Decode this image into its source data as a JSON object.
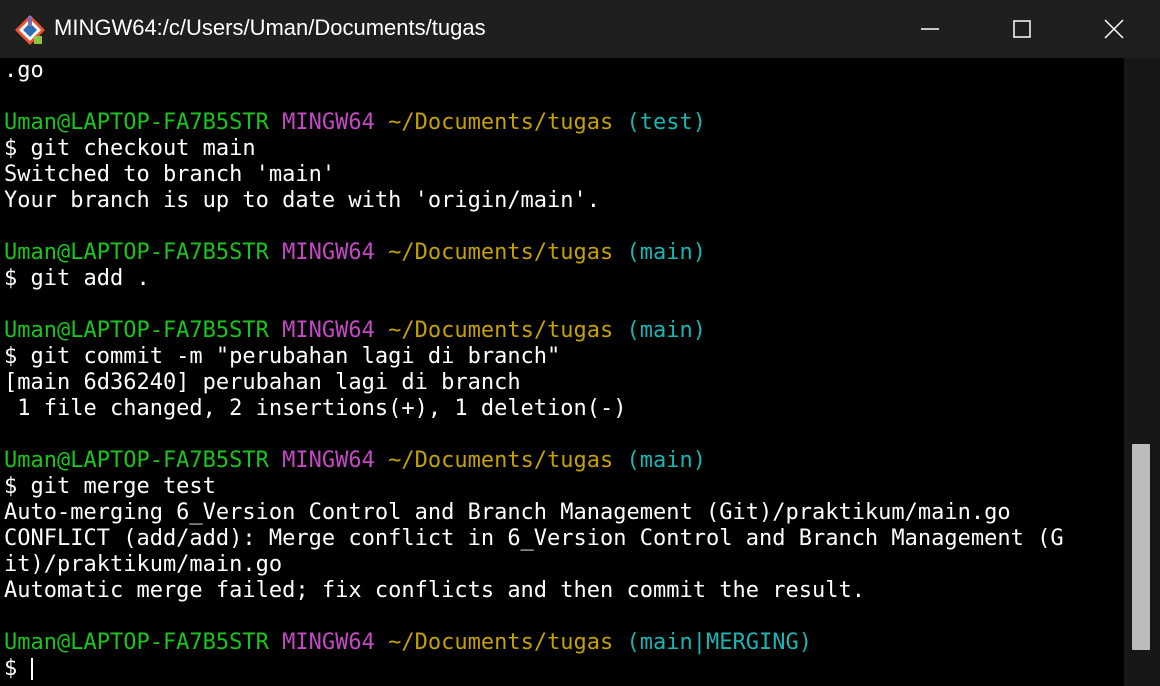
{
  "window": {
    "title": "MINGW64:/c/Users/Uman/Documents/tugas",
    "controls": [
      "minimize",
      "maximize",
      "close"
    ]
  },
  "prompt": {
    "user_host": "Uman@LAPTOP-FA7B5STR",
    "shell": "MINGW64",
    "path": "~/Documents/tugas"
  },
  "terminal": {
    "lines": [
      {
        "kind": "text",
        "text": ".go"
      },
      {
        "kind": "blank",
        "text": ""
      },
      {
        "kind": "prompt",
        "branch": "(test)"
      },
      {
        "kind": "text",
        "text": "$ git checkout main"
      },
      {
        "kind": "text",
        "text": "Switched to branch 'main'"
      },
      {
        "kind": "text",
        "text": "Your branch is up to date with 'origin/main'."
      },
      {
        "kind": "blank",
        "text": ""
      },
      {
        "kind": "prompt",
        "branch": "(main)"
      },
      {
        "kind": "text",
        "text": "$ git add ."
      },
      {
        "kind": "blank",
        "text": ""
      },
      {
        "kind": "prompt",
        "branch": "(main)"
      },
      {
        "kind": "text",
        "text": "$ git commit -m \"perubahan lagi di branch\""
      },
      {
        "kind": "text",
        "text": "[main 6d36240] perubahan lagi di branch"
      },
      {
        "kind": "text",
        "text": " 1 file changed, 2 insertions(+), 1 deletion(-)"
      },
      {
        "kind": "blank",
        "text": ""
      },
      {
        "kind": "prompt",
        "branch": "(main)"
      },
      {
        "kind": "text",
        "text": "$ git merge test"
      },
      {
        "kind": "text",
        "text": "Auto-merging 6_Version Control and Branch Management (Git)/praktikum/main.go"
      },
      {
        "kind": "text",
        "text": "CONFLICT (add/add): Merge conflict in 6_Version Control and Branch Management (G"
      },
      {
        "kind": "text",
        "text": "it)/praktikum/main.go"
      },
      {
        "kind": "text",
        "text": "Automatic merge failed; fix conflicts and then commit the result."
      },
      {
        "kind": "blank",
        "text": ""
      },
      {
        "kind": "prompt",
        "branch": "(main|MERGING)"
      },
      {
        "kind": "input",
        "text": "$ "
      }
    ]
  },
  "colors": {
    "user_host": "#18c51a",
    "shell": "#c448c4",
    "path": "#c4a000",
    "branch": "#19b4b4",
    "text": "#ffffff",
    "background": "#000000"
  }
}
